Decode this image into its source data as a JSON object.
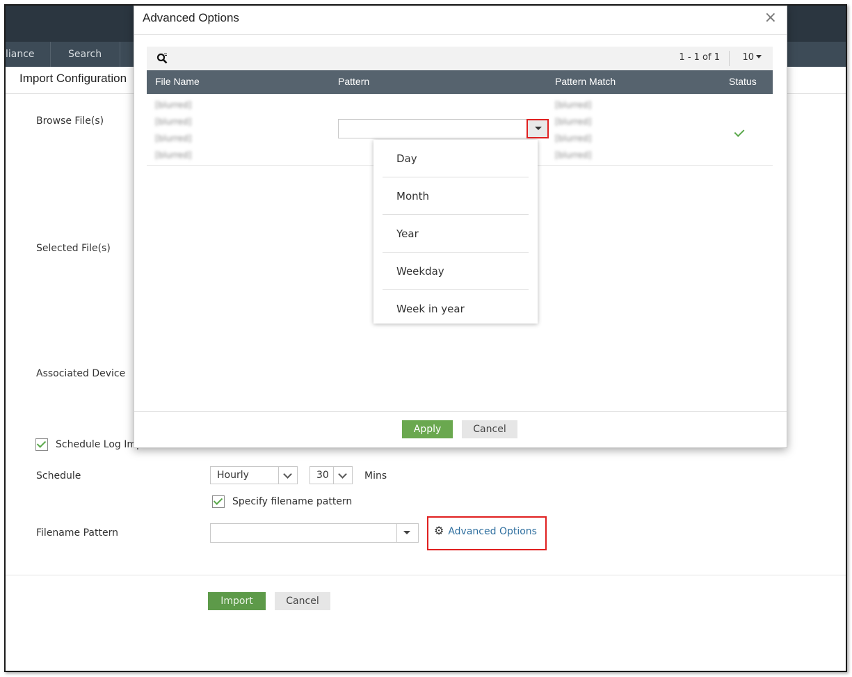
{
  "nav": {
    "items": [
      "liance",
      "Search"
    ]
  },
  "page": {
    "title": "Import Configuration"
  },
  "form": {
    "browse_label": "Browse File(s)",
    "selected_label": "Selected File(s)",
    "device_label": "Associated Device",
    "schedule_checkbox_label": "Schedule Log Import",
    "schedule_label": "Schedule",
    "schedule_value": "Hourly",
    "minutes_value": "30",
    "minutes_unit": "Mins",
    "pattern_checkbox_label": "Specify filename pattern",
    "filename_pattern_label": "Filename Pattern",
    "filename_pattern_value": "",
    "advanced_link": "Advanced Options",
    "import_button": "Import",
    "cancel_button": "Cancel"
  },
  "modal": {
    "title": "Advanced Options",
    "close_glyph": "×",
    "paging": "1 - 1 of 1",
    "page_size": "10",
    "columns": [
      "File Name",
      "Pattern",
      "Pattern Match",
      "Status"
    ],
    "row": {
      "file_name_lines": [
        "[blurred]",
        "[blurred]",
        "[blurred]",
        "[blurred]"
      ],
      "pattern_value": "",
      "pattern_match_lines": [
        "[blurred]",
        "[blurred]",
        "[blurred]",
        "[blurred]"
      ],
      "status": "✓"
    },
    "dropdown_options": [
      "Day",
      "Month",
      "Year",
      "Weekday",
      "Week in year"
    ],
    "apply_button": "Apply",
    "cancel_button": "Cancel"
  },
  "colors": {
    "accent_green": "#6aa84f",
    "highlight_red": "#e02020",
    "header_dark": "#56636e",
    "link_blue": "#2f6f9f"
  }
}
